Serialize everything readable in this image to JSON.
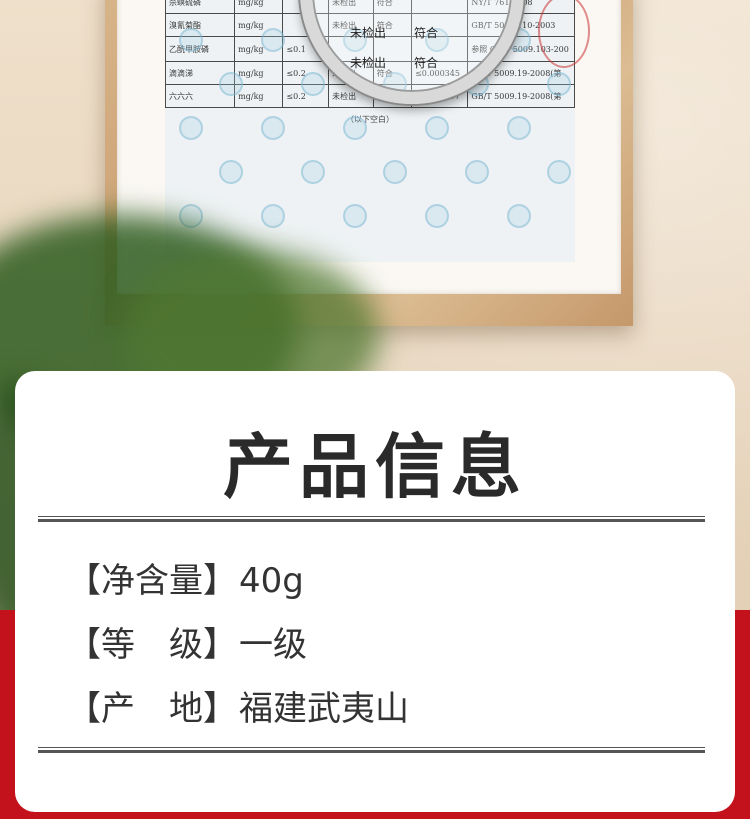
{
  "report": {
    "rows": [
      [
        "杀螟硫磷",
        "mg/kg",
        "",
        "未检出",
        "符合",
        "",
        "NY/T 761-2008"
      ],
      [
        "溴氰菊酯",
        "mg/kg",
        "",
        "未检出",
        "符合",
        "",
        "GB/T 5009.110-2003"
      ],
      [
        "乙酰甲胺磷",
        "mg/kg",
        "≤0.1",
        "",
        "",
        "",
        "参照 GB/T 5009.103-200"
      ],
      [
        "滴滴涕",
        "mg/kg",
        "≤0.2",
        "未检出",
        "符合",
        "≤0.000345",
        "GB/T 5009.19-2008(第"
      ],
      [
        "六六六",
        "mg/kg",
        "≤0.2",
        "未检出",
        "符合",
        "≤0.000097",
        "GB/T 5009.19-2008(第"
      ]
    ],
    "end_note": "（以下空白）"
  },
  "magnifier": {
    "cells": [
      "未检出",
      "符合",
      "未检出",
      "符合"
    ]
  },
  "info": {
    "title": "产品信息",
    "items": [
      {
        "key": "【净含量】",
        "value": "40g"
      },
      {
        "key": "【等　级】",
        "value": "一级"
      },
      {
        "key": "【产　地】",
        "value": "福建武夷山"
      }
    ]
  },
  "colors": {
    "accent_red": "#c3121b",
    "card_bg": "#ffffff",
    "text_dark": "#333333"
  }
}
